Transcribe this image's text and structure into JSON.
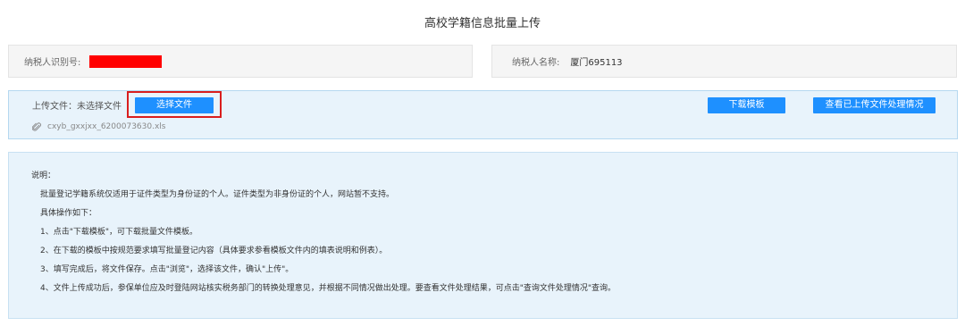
{
  "title": "高校学籍信息批量上传",
  "taxpayer": {
    "id_label": "纳税人识别号:",
    "name_label": "纳税人名称:",
    "name_value": "厦门695113"
  },
  "upload": {
    "label": "上传文件：未选择文件",
    "choose_button": "选择文件",
    "download_template_button": "下载模板",
    "view_status_button": "查看已上传文件处理情况",
    "file_name": "cxyb_gxxjxx_6200073630.xls"
  },
  "instructions": {
    "heading": "说明：",
    "lines": [
      "批量登记学籍系统仅适用于证件类型为身份证的个人。证件类型为非身份证的个人，网站暂不支持。",
      "具体操作如下：",
      "1、点击\"下载模板\"，可下载批量文件模板。",
      "2、在下载的模板中按规范要求填写批量登记内容（具体要求参看模板文件内的填表说明和例表）。",
      "3、填写完成后，将文件保存。点击\"浏览\"，选择该文件，确认\"上传\"。",
      "4、文件上传成功后，参保单位应及时登陆网站核实税务部门的转换处理意见，并根据不同情况做出处理。要查看文件处理结果，可点击\"查询文件处理情况\"查询。"
    ]
  },
  "colors": {
    "accent": "#1e90ff",
    "highlight": "#d91e1e",
    "redaction": "#ff0000",
    "panel_bg": "#e8f3fb"
  },
  "icons": {
    "file": "paperclip-icon"
  }
}
